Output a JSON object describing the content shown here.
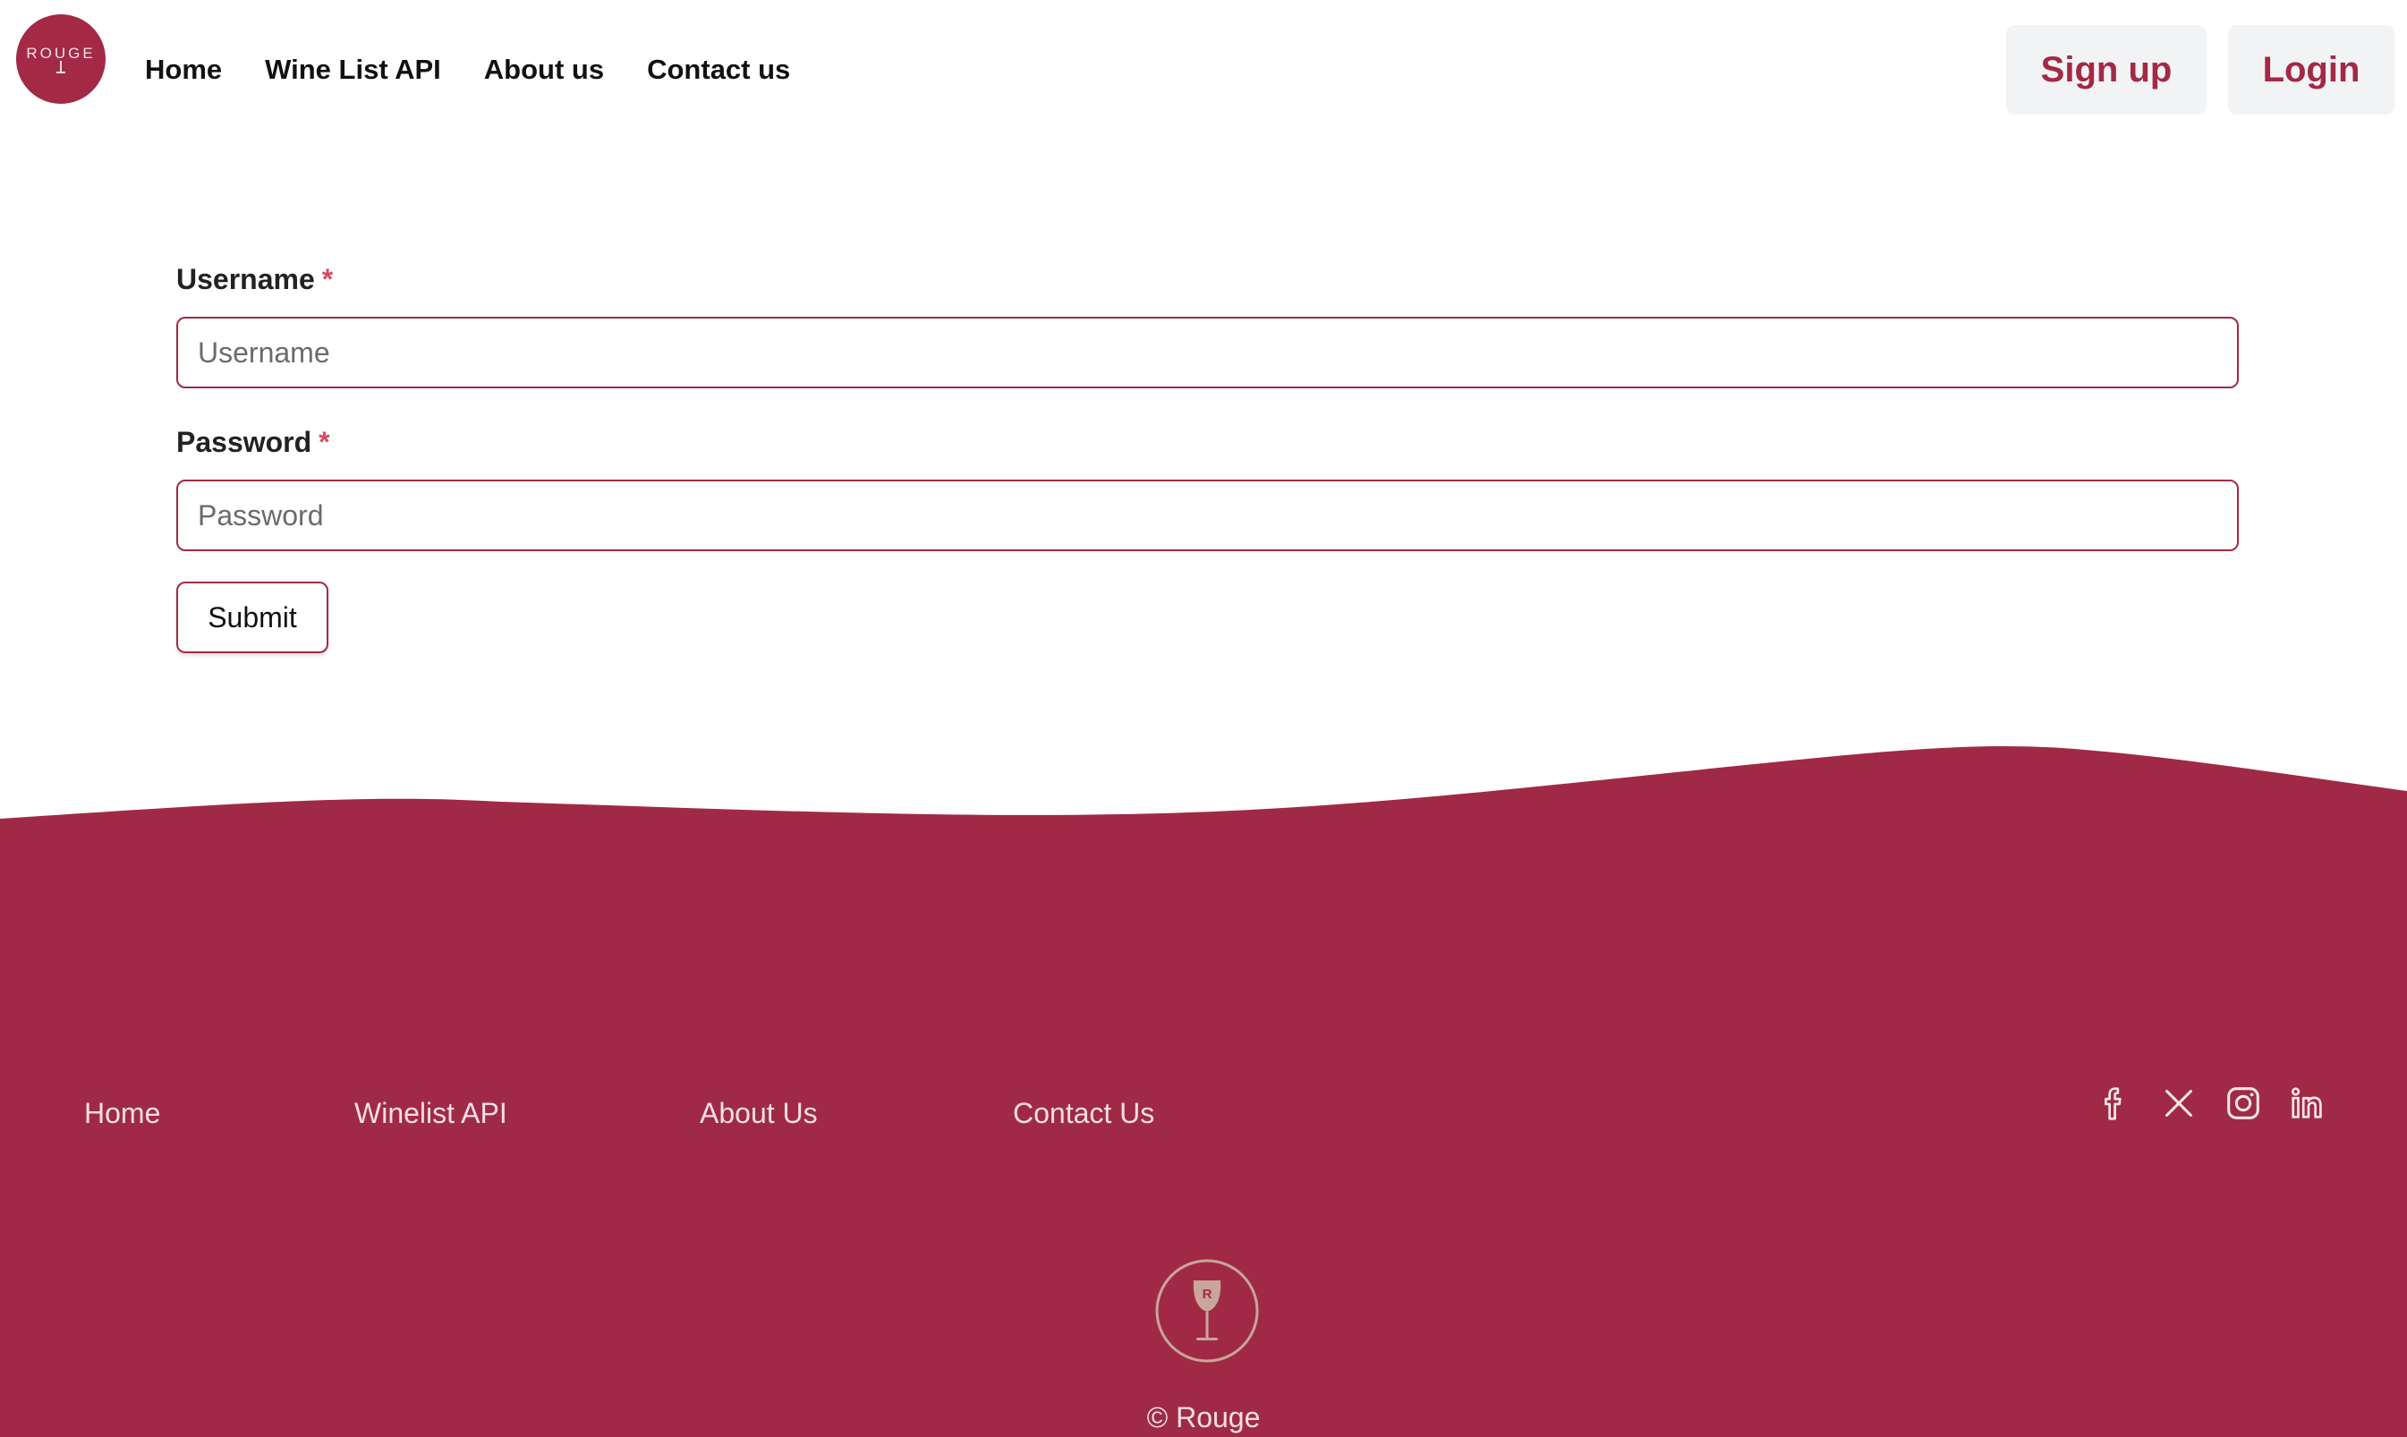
{
  "brand": {
    "logo_text": "ROUGE",
    "accent": "#a32944"
  },
  "nav": [
    {
      "label": "Home"
    },
    {
      "label": "Wine List API"
    },
    {
      "label": "About us"
    },
    {
      "label": "Contact us"
    }
  ],
  "auth": {
    "signup_label": "Sign up",
    "login_label": "Login"
  },
  "form": {
    "username": {
      "label": "Username",
      "required_mark": "*",
      "placeholder": "Username",
      "value": ""
    },
    "password": {
      "label": "Password",
      "required_mark": "*",
      "placeholder": "Password",
      "value": ""
    },
    "submit_label": "Submit"
  },
  "footer": {
    "links": [
      {
        "label": "Home"
      },
      {
        "label": "Winelist API"
      },
      {
        "label": "About Us"
      },
      {
        "label": "Contact Us"
      }
    ],
    "social": [
      "facebook-icon",
      "x-icon",
      "instagram-icon",
      "linkedin-icon"
    ],
    "logo_letter": "R",
    "copyright": "© Rouge",
    "background": "#a02a45",
    "text_color": "#f1dfe3"
  }
}
